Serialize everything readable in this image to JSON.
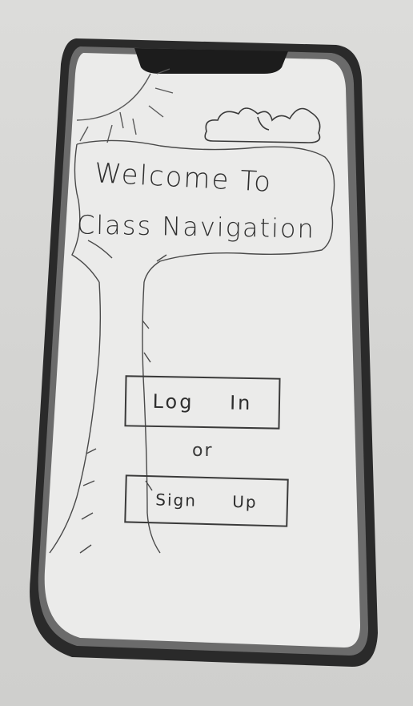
{
  "welcome": {
    "title_line_1": "Welcome To",
    "title_line_2": "Class Navigation"
  },
  "auth": {
    "login_label": "Log In",
    "separator": "or",
    "signup_label": "Sign Up"
  },
  "sketch": {
    "icons": [
      "sun-icon",
      "cloud-icon",
      "tree-icon"
    ],
    "ink_color": "#2e2e2e",
    "paper_color": "#ebebea"
  }
}
